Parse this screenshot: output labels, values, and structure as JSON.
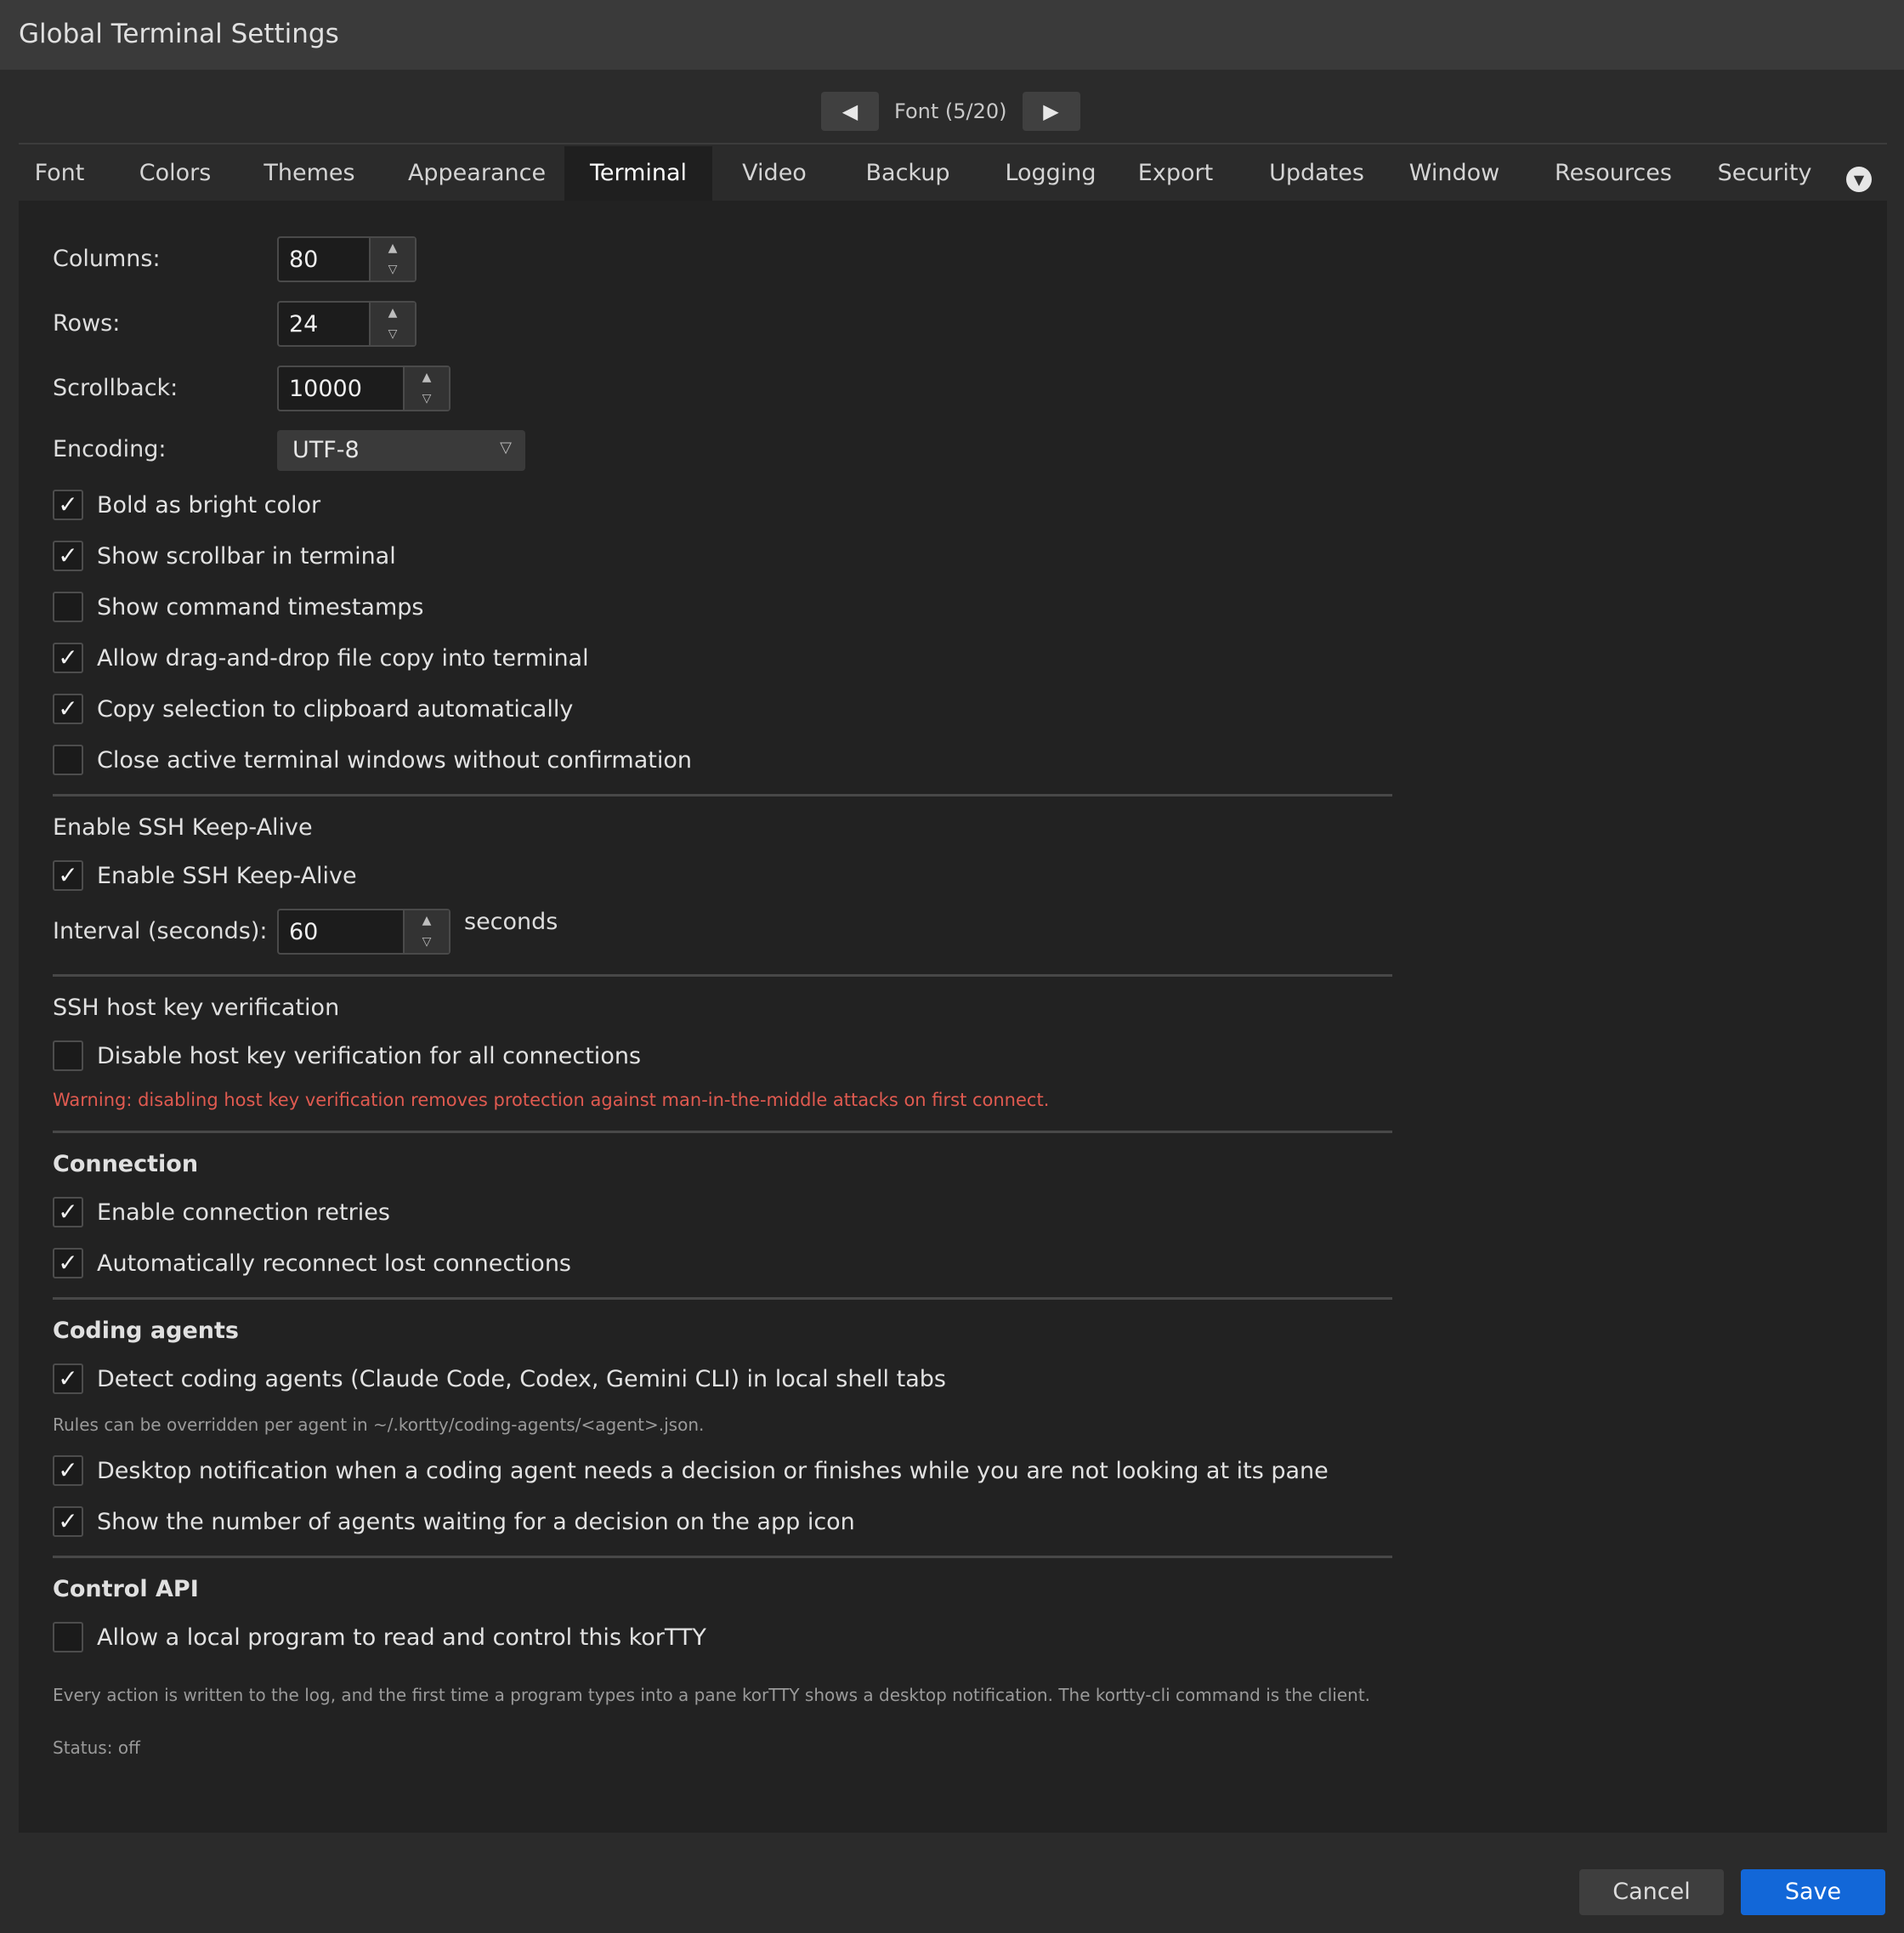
{
  "window": {
    "title": "Global Terminal Settings"
  },
  "pager": {
    "prev_icon": "◀",
    "label": "Font  (5/20)",
    "next_icon": "▶"
  },
  "tabs": [
    {
      "label": "Font"
    },
    {
      "label": "Colors"
    },
    {
      "label": "Themes"
    },
    {
      "label": "Appearance"
    },
    {
      "label": "Terminal",
      "active": true
    },
    {
      "label": "Video"
    },
    {
      "label": "Backup"
    },
    {
      "label": "Logging"
    },
    {
      "label": "Export"
    },
    {
      "label": "Updates"
    },
    {
      "label": "Window"
    },
    {
      "label": "Resources"
    },
    {
      "label": "Security"
    }
  ],
  "terminal": {
    "columns_label": "Columns:",
    "columns_value": "80",
    "rows_label": "Rows:",
    "rows_value": "24",
    "scrollback_label": "Scrollback:",
    "scrollback_value": "10000",
    "encoding_label": "Encoding:",
    "encoding_value": "UTF-8",
    "checkboxes": [
      {
        "label": "Bold as bright color",
        "checked": true
      },
      {
        "label": "Show scrollbar in terminal",
        "checked": true
      },
      {
        "label": "Show command timestamps",
        "checked": false
      },
      {
        "label": "Allow drag-and-drop file copy into terminal",
        "checked": true
      },
      {
        "label": "Copy selection to clipboard automatically",
        "checked": true
      },
      {
        "label": "Close active terminal windows without confirmation",
        "checked": false
      }
    ]
  },
  "keepalive": {
    "heading": "Enable SSH Keep-Alive",
    "checkbox": {
      "label": "Enable SSH Keep-Alive",
      "checked": true
    },
    "interval_label": "Interval (seconds):",
    "interval_value": "60",
    "unit": "seconds"
  },
  "hostkey": {
    "heading": "SSH host key verification",
    "checkbox": {
      "label": "Disable host key verification for all connections",
      "checked": false
    },
    "warning": "Warning: disabling host key verification removes protection against man-in-the-middle attacks on first connect."
  },
  "connection": {
    "heading": "Connection",
    "checkboxes": [
      {
        "label": "Enable connection retries",
        "checked": true
      },
      {
        "label": "Automatically reconnect lost connections",
        "checked": true
      }
    ]
  },
  "agents": {
    "heading": "Coding agents",
    "detect": {
      "label": "Detect coding agents (Claude Code, Codex, Gemini CLI) in local shell tabs",
      "checked": true
    },
    "note": "Rules can be overridden per agent in ~/.kortty/coding-agents/<agent>.json.",
    "notify": {
      "label": "Desktop notification when a coding agent needs a decision or finishes while you are not looking at its pane",
      "checked": true
    },
    "badge": {
      "label": "Show the number of agents waiting for a decision on the app icon",
      "checked": true
    }
  },
  "control_api": {
    "heading": "Control API",
    "checkbox": {
      "label": "Allow a local program to read and control this korTTY",
      "checked": false
    },
    "note": "Every action is written to the log, and the first time a program types into a pane korTTY shows a desktop notification. The kortty-cli command is the client.",
    "status": "Status: off"
  },
  "footer": {
    "cancel_label": "Cancel",
    "save_label": "Save"
  },
  "icons": {
    "check": "✓",
    "spin_up": "▲",
    "spin_down": "▽",
    "dropdown": "▽",
    "more": "▼"
  },
  "colors": {
    "accent": "#1267d8",
    "warning": "#e05a50"
  }
}
